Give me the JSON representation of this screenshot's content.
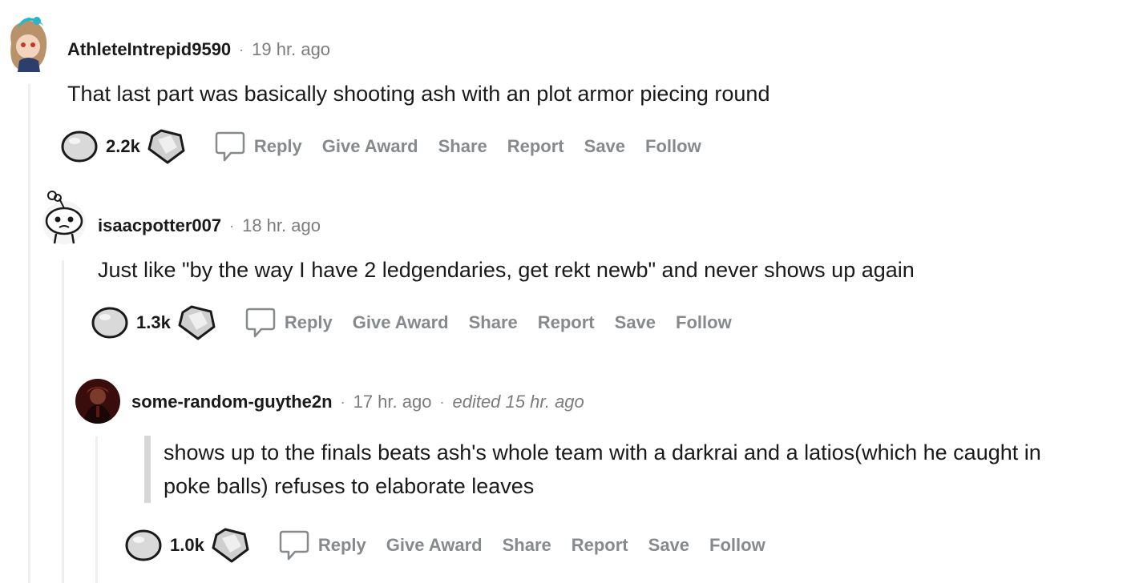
{
  "comments": [
    {
      "username": "AthleteIntrepid9590",
      "time": "19 hr. ago",
      "body": "That last part was basically shooting ash with an plot armor piecing round",
      "score": "2.2k",
      "actions": {
        "reply": "Reply",
        "award": "Give Award",
        "share": "Share",
        "report": "Report",
        "save": "Save",
        "follow": "Follow"
      }
    },
    {
      "username": "isaacpotter007",
      "time": "18 hr. ago",
      "body": "Just like \"by the way I have 2 ledgendaries, get rekt newb\" and never shows up again",
      "score": "1.3k",
      "actions": {
        "reply": "Reply",
        "award": "Give Award",
        "share": "Share",
        "report": "Report",
        "save": "Save",
        "follow": "Follow"
      }
    },
    {
      "username": "some-random-guythe2n",
      "time": "17 hr. ago",
      "edited": "edited 15 hr. ago",
      "body": "shows up to the finals beats ash's whole team with a darkrai and a latios(which he caught in poke balls) refuses to elaborate leaves",
      "score": "1.0k",
      "actions": {
        "reply": "Reply",
        "award": "Give Award",
        "share": "Share",
        "report": "Report",
        "save": "Save",
        "follow": "Follow"
      }
    }
  ],
  "separator": "·",
  "colors": {
    "text": "#1a1a1b",
    "meta": "#7c7c7c",
    "action": "#878a8c",
    "thread_line": "#edeff1",
    "quote_bar": "#d7d7d7"
  },
  "icons": [
    "upvote-orb-icon",
    "award-gem-icon",
    "reply-bubble-icon"
  ]
}
